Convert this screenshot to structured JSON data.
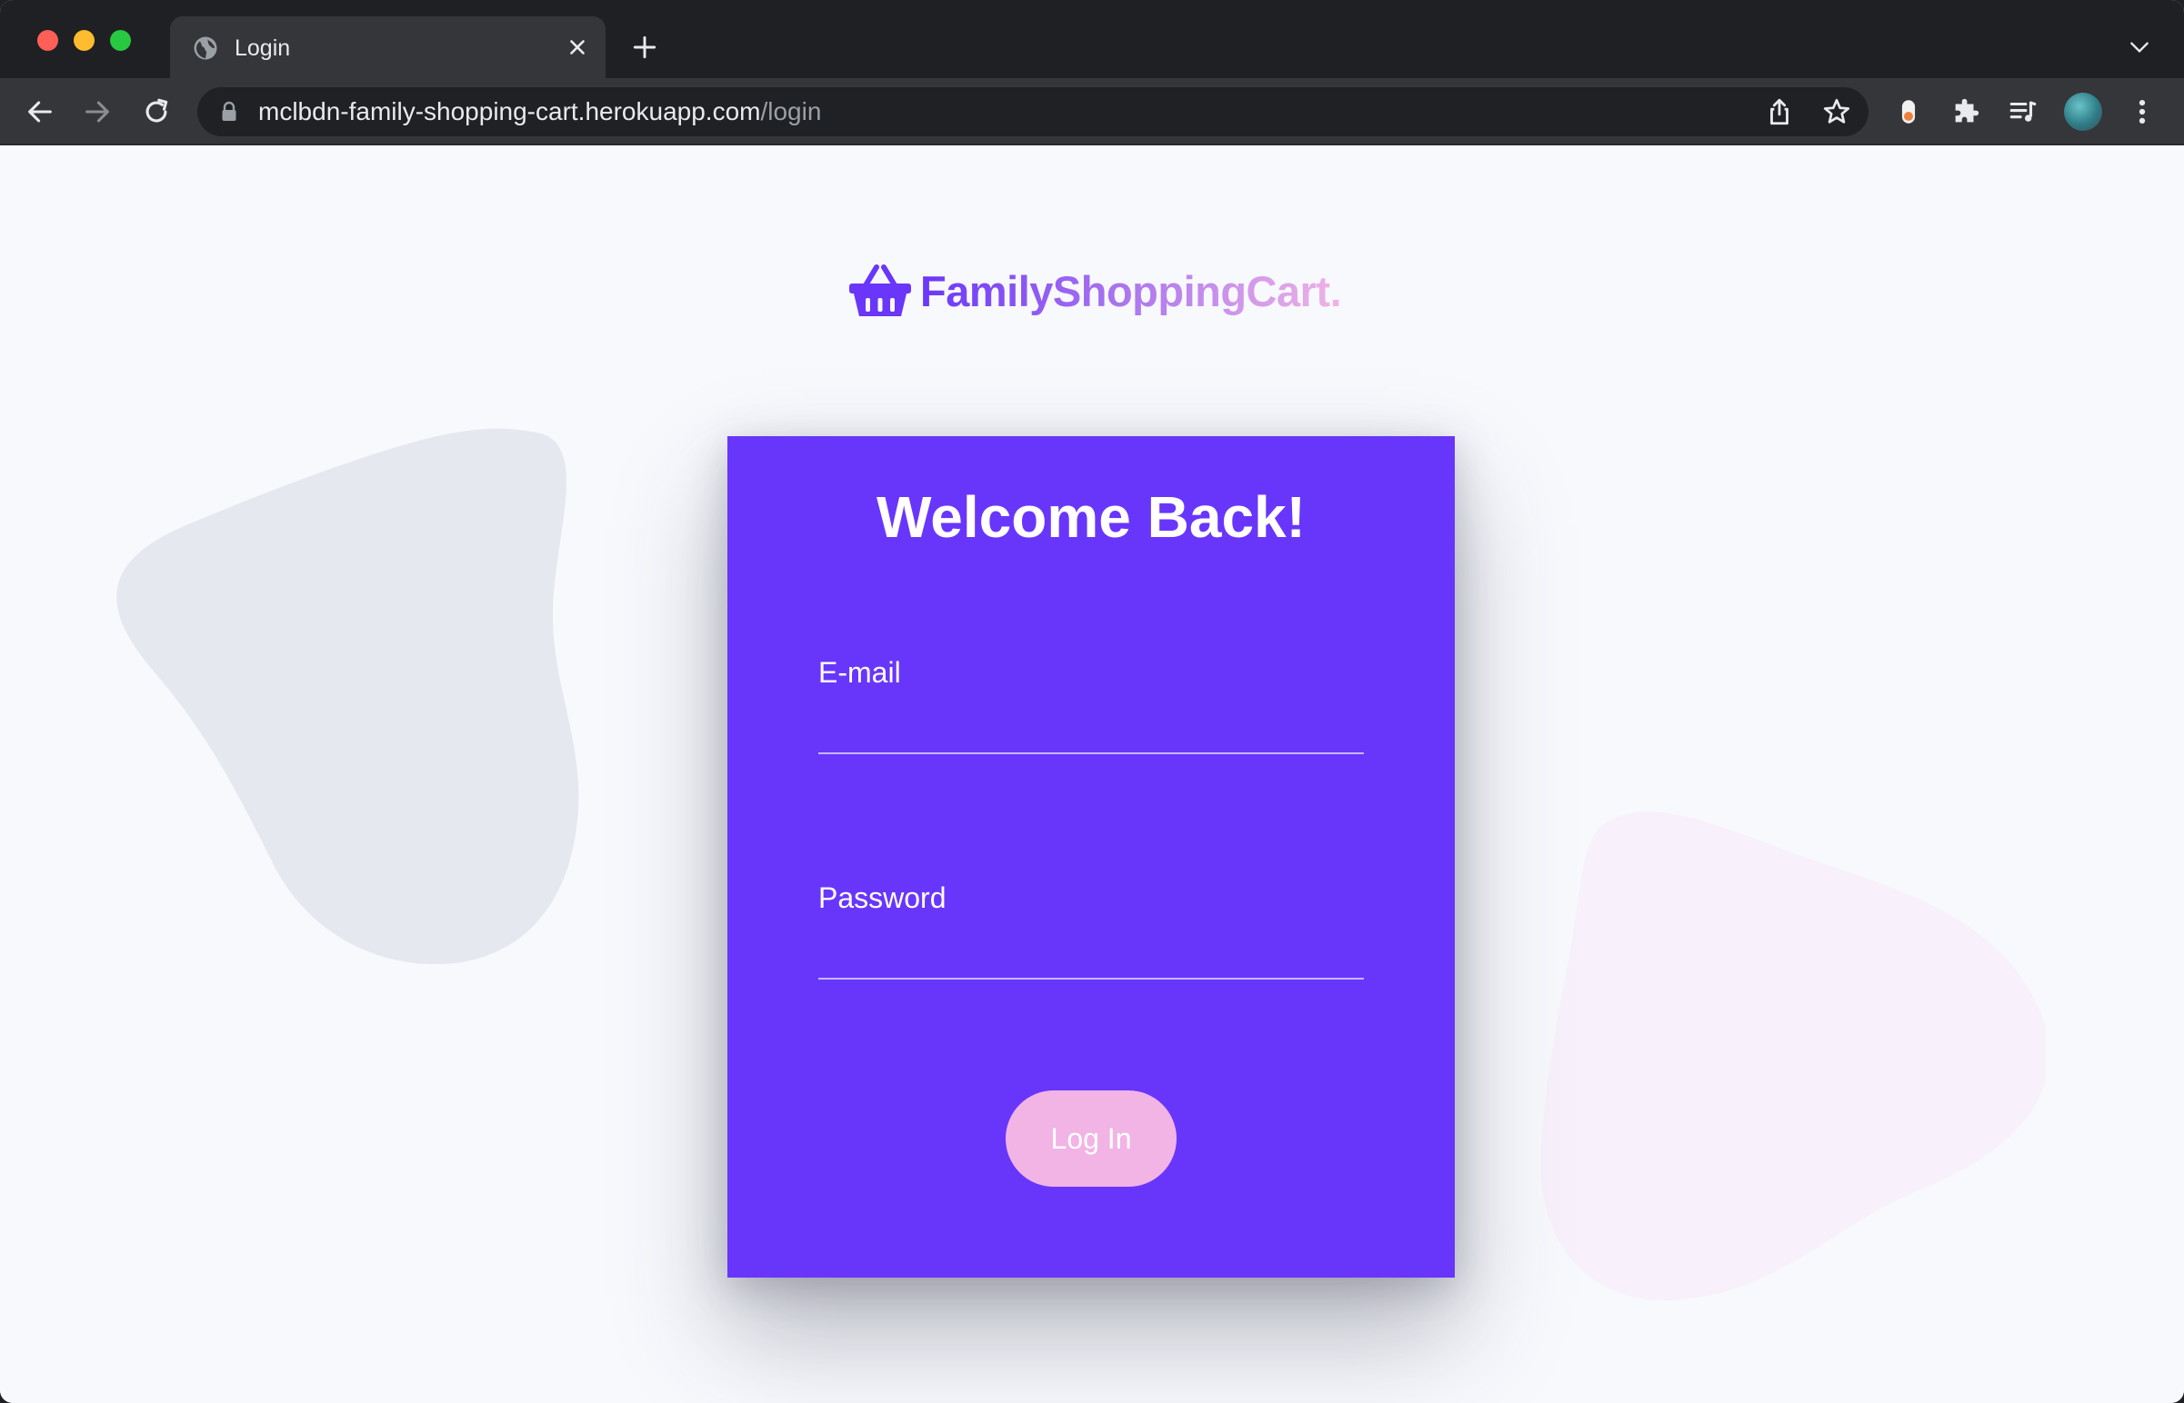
{
  "browser": {
    "tab": {
      "title": "Login"
    },
    "address": {
      "host": "mclbdn-family-shopping-cart.herokuapp.com",
      "path": "/login"
    }
  },
  "brand": {
    "name": "FamilyShoppingCart."
  },
  "login": {
    "title": "Welcome Back!",
    "email_label": "E-mail",
    "email_value": "",
    "password_label": "Password",
    "password_value": "",
    "submit_label": "Log In"
  },
  "colors": {
    "card": "#6836fb",
    "button": "#f2b4e4",
    "brand_start": "#6a36f9",
    "brand_end": "#f0b4e6",
    "background": "#f7f9fd"
  },
  "icons": {
    "brand": "shopping-basket-icon",
    "tab": "globe-icon",
    "back": "arrow-left-icon",
    "forward": "arrow-right-icon",
    "reload": "reload-icon",
    "lock": "lock-icon",
    "share": "share-icon",
    "bookmark": "star-icon",
    "extension": "puzzle-icon",
    "reading_list": "media-list-icon",
    "menu": "kebab-menu-icon"
  }
}
